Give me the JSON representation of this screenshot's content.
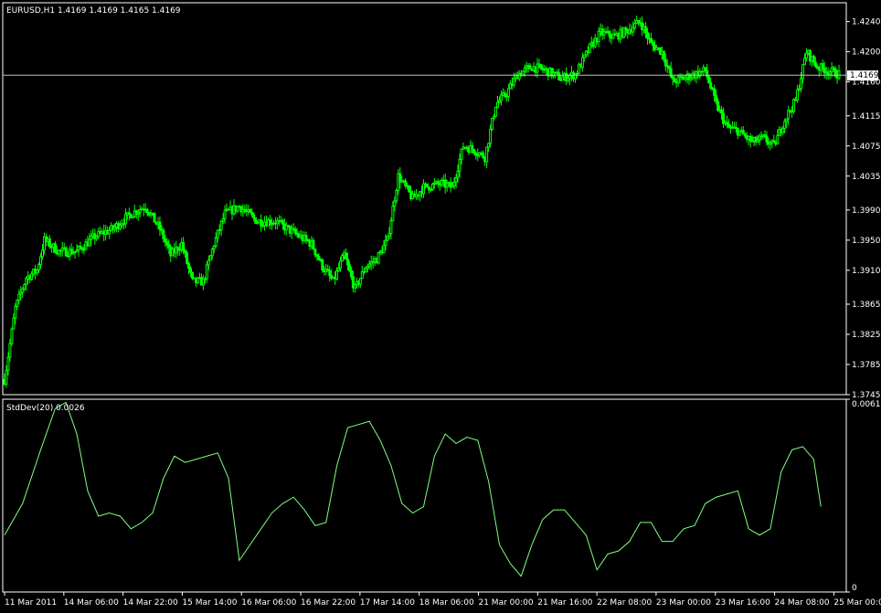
{
  "colors": {
    "background": "#000000",
    "frame": "#ffffff",
    "bull_candle": "#00ff00",
    "bear_candle": "#00ff00",
    "indicator_line": "#7fff7f",
    "current_price_line": "#c0c0c0",
    "price_tag_bg": "#ffffff",
    "price_tag_text": "#000000"
  },
  "main_panel": {
    "title": "EURUSD,H1  1.4169 1.4169 1.4165 1.4169",
    "current_price": "1.4169"
  },
  "indicator_panel": {
    "title": "StdDev(20) 0.0026"
  },
  "chart_data": [
    {
      "type": "candlestick",
      "symbol": "EURUSD",
      "timeframe": "H1",
      "ylim": [
        1.3745,
        1.4265
      ],
      "y_ticks": [
        "1.4240",
        "1.4200",
        "1.4160",
        "1.4115",
        "1.4075",
        "1.4035",
        "1.3990",
        "1.3950",
        "1.3910",
        "1.3865",
        "1.3825",
        "1.3785",
        "1.3745"
      ],
      "x_ticks": [
        "11 Mar 2011",
        "14 Mar 06:00",
        "14 Mar 22:00",
        "15 Mar 14:00",
        "16 Mar 06:00",
        "16 Mar 22:00",
        "17 Mar 14:00",
        "18 Mar 06:00",
        "21 Mar 00:00",
        "21 Mar 16:00",
        "22 Mar 08:00",
        "23 Mar 00:00",
        "23 Mar 16:00",
        "24 Mar 08:00",
        "25 Mar 00:00"
      ],
      "close_path": [
        [
          0,
          1.3765
        ],
        [
          6,
          1.386
        ],
        [
          12,
          1.39
        ],
        [
          18,
          1.391
        ],
        [
          22,
          1.395
        ],
        [
          30,
          1.3935
        ],
        [
          40,
          1.3935
        ],
        [
          50,
          1.3955
        ],
        [
          60,
          1.3965
        ],
        [
          70,
          1.3985
        ],
        [
          78,
          1.3995
        ],
        [
          86,
          1.3965
        ],
        [
          92,
          1.393
        ],
        [
          98,
          1.3945
        ],
        [
          104,
          1.3895
        ],
        [
          110,
          1.3895
        ],
        [
          116,
          1.3945
        ],
        [
          122,
          1.3985
        ],
        [
          130,
          1.3995
        ],
        [
          140,
          1.3975
        ],
        [
          150,
          1.3975
        ],
        [
          160,
          1.396
        ],
        [
          170,
          1.3945
        ],
        [
          176,
          1.3915
        ],
        [
          182,
          1.3895
        ],
        [
          188,
          1.393
        ],
        [
          194,
          1.3885
        ],
        [
          200,
          1.3915
        ],
        [
          206,
          1.3925
        ],
        [
          212,
          1.395
        ],
        [
          218,
          1.4035
        ],
        [
          226,
          1.4005
        ],
        [
          232,
          1.402
        ],
        [
          242,
          1.4025
        ],
        [
          248,
          1.402
        ],
        [
          254,
          1.4075
        ],
        [
          260,
          1.407
        ],
        [
          266,
          1.406
        ],
        [
          272,
          1.413
        ],
        [
          278,
          1.4145
        ],
        [
          284,
          1.417
        ],
        [
          292,
          1.418
        ],
        [
          300,
          1.4175
        ],
        [
          308,
          1.4165
        ],
        [
          316,
          1.417
        ],
        [
          324,
          1.4205
        ],
        [
          330,
          1.4225
        ],
        [
          338,
          1.422
        ],
        [
          346,
          1.423
        ],
        [
          352,
          1.424
        ],
        [
          358,
          1.421
        ],
        [
          364,
          1.42
        ],
        [
          370,
          1.416
        ],
        [
          376,
          1.4165
        ],
        [
          382,
          1.417
        ],
        [
          388,
          1.4175
        ],
        [
          394,
          1.413
        ],
        [
          400,
          1.41
        ],
        [
          406,
          1.4095
        ],
        [
          414,
          1.408
        ],
        [
          420,
          1.4085
        ],
        [
          426,
          1.4075
        ],
        [
          432,
          1.411
        ],
        [
          438,
          1.4135
        ],
        [
          444,
          1.42
        ],
        [
          450,
          1.418
        ],
        [
          456,
          1.4175
        ],
        [
          462,
          1.417
        ]
      ]
    },
    {
      "type": "line",
      "name": "StdDev(20)",
      "ylim": [
        0,
        0.0061
      ],
      "y_ticks": [
        "0.0061",
        "0"
      ],
      "values_path": [
        [
          0,
          0.0018
        ],
        [
          10,
          0.0028
        ],
        [
          20,
          0.0045
        ],
        [
          28,
          0.0058
        ],
        [
          34,
          0.006
        ],
        [
          40,
          0.005
        ],
        [
          46,
          0.0032
        ],
        [
          52,
          0.0024
        ],
        [
          58,
          0.0025
        ],
        [
          64,
          0.0024
        ],
        [
          70,
          0.002
        ],
        [
          76,
          0.0022
        ],
        [
          82,
          0.0025
        ],
        [
          88,
          0.0036
        ],
        [
          94,
          0.0043
        ],
        [
          100,
          0.0041
        ],
        [
          106,
          0.0042
        ],
        [
          112,
          0.0043
        ],
        [
          118,
          0.0044
        ],
        [
          124,
          0.0036
        ],
        [
          130,
          0.001
        ],
        [
          136,
          0.0015
        ],
        [
          142,
          0.002
        ],
        [
          148,
          0.0025
        ],
        [
          154,
          0.0028
        ],
        [
          160,
          0.003
        ],
        [
          166,
          0.0026
        ],
        [
          172,
          0.0021
        ],
        [
          178,
          0.0022
        ],
        [
          184,
          0.004
        ],
        [
          190,
          0.0052
        ],
        [
          196,
          0.0053
        ],
        [
          202,
          0.0054
        ],
        [
          208,
          0.0048
        ],
        [
          214,
          0.004
        ],
        [
          220,
          0.0028
        ],
        [
          226,
          0.0025
        ],
        [
          232,
          0.0027
        ],
        [
          238,
          0.0043
        ],
        [
          244,
          0.005
        ],
        [
          250,
          0.0047
        ],
        [
          256,
          0.0049
        ],
        [
          262,
          0.0048
        ],
        [
          268,
          0.0035
        ],
        [
          274,
          0.0015
        ],
        [
          280,
          0.0009
        ],
        [
          286,
          0.0005
        ],
        [
          292,
          0.0015
        ],
        [
          298,
          0.0023
        ],
        [
          304,
          0.0026
        ],
        [
          310,
          0.0026
        ],
        [
          316,
          0.0022
        ],
        [
          322,
          0.0018
        ],
        [
          328,
          0.0007
        ],
        [
          334,
          0.0012
        ],
        [
          340,
          0.0013
        ],
        [
          346,
          0.0016
        ],
        [
          352,
          0.0022
        ],
        [
          358,
          0.0022
        ],
        [
          364,
          0.0016
        ],
        [
          370,
          0.0016
        ],
        [
          376,
          0.002
        ],
        [
          382,
          0.0021
        ],
        [
          388,
          0.0028
        ],
        [
          394,
          0.003
        ],
        [
          400,
          0.0031
        ],
        [
          406,
          0.0032
        ],
        [
          412,
          0.002
        ],
        [
          418,
          0.0018
        ],
        [
          424,
          0.002
        ],
        [
          430,
          0.0038
        ],
        [
          436,
          0.0045
        ],
        [
          442,
          0.0046
        ],
        [
          448,
          0.0042
        ],
        [
          452,
          0.0027
        ]
      ]
    }
  ]
}
